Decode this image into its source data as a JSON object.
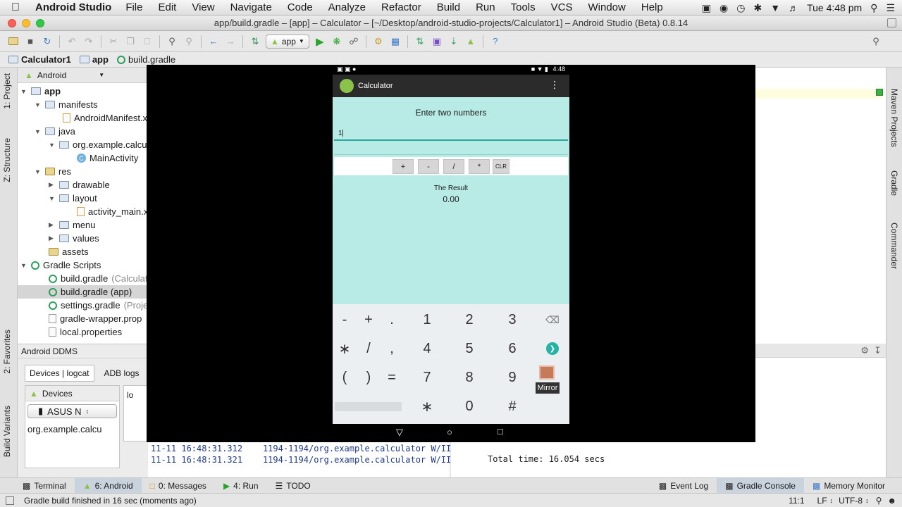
{
  "menubar": {
    "app_name": "Android Studio",
    "items": [
      "File",
      "Edit",
      "View",
      "Navigate",
      "Code",
      "Analyze",
      "Refactor",
      "Build",
      "Run",
      "Tools",
      "VCS",
      "Window",
      "Help"
    ],
    "clock": "Tue 4:48 pm"
  },
  "window": {
    "title": "app/build.gradle – [app] – Calculator – [~/Desktop/android-studio-projects/Calculator1] – Android Studio (Beta) 0.8.14"
  },
  "toolbar": {
    "run_config": "app"
  },
  "breadcrumb": [
    "Calculator1",
    "app",
    "build.gradle"
  ],
  "left_strip": {
    "project": "1: Project",
    "structure": "Z: Structure",
    "favorites": "2: Favorites",
    "build_variants": "Build Variants"
  },
  "right_strip": {
    "maven": "Maven Projects",
    "gradle": "Gradle",
    "commander": "Commander"
  },
  "project_panel": {
    "view_mode": "Android",
    "tree": [
      {
        "label": "app",
        "bold": true
      },
      {
        "label": "manifests"
      },
      {
        "label": "AndroidManifest.x"
      },
      {
        "label": "java"
      },
      {
        "label": "org.example.calcu"
      },
      {
        "label": "MainActivity"
      },
      {
        "label": "res"
      },
      {
        "label": "drawable"
      },
      {
        "label": "layout"
      },
      {
        "label": "activity_main.x"
      },
      {
        "label": "menu"
      },
      {
        "label": "values"
      },
      {
        "label": "assets"
      },
      {
        "label": "Gradle Scripts"
      },
      {
        "label": "build.gradle",
        "hint": "(Calculat"
      },
      {
        "label": "build.gradle (app)"
      },
      {
        "label": "settings.gradle",
        "hint": "(Proje"
      },
      {
        "label": "gradle-wrapper.prop"
      },
      {
        "label": "local.properties"
      }
    ]
  },
  "ddms": {
    "title": "Android DDMS",
    "tabs": [
      "Devices | logcat",
      "ADB logs"
    ],
    "devices_label": "Devices",
    "device_select": "ASUS N",
    "process": "org.example.calcu",
    "log_tab": "lo"
  },
  "logcat": [
    {
      "time": "11-11 16:48:31.312",
      "msg": "1194-1194/org.example.calculator W/II"
    },
    {
      "time": "11-11 16:48:31.321",
      "msg": "1194-1194/org.example.calculator W/II"
    }
  ],
  "gradle_console": {
    "total_time": "Total time: 16.054 secs"
  },
  "phone": {
    "status_time": "4:48",
    "app_title": "Calculator",
    "prompt": "Enter two numbers",
    "input1_value": "1",
    "ops": [
      "+",
      "-",
      "/",
      "*",
      "CLR"
    ],
    "result_label": "The Result",
    "result_value": "0.00",
    "keyboard": {
      "row1": [
        "-",
        "+",
        ".",
        "1",
        "2",
        "3"
      ],
      "row2": [
        "∗",
        "/",
        ",",
        "4",
        "5",
        "6"
      ],
      "row3": [
        "(",
        ")",
        "=",
        "7",
        "8",
        "9"
      ],
      "row4": [
        "∗",
        "0",
        "#"
      ],
      "mirror_label": "Mirror"
    }
  },
  "bottom_tabs": [
    {
      "label": "Terminal"
    },
    {
      "label": "6: Android"
    },
    {
      "label": "0: Messages"
    },
    {
      "label": "4: Run"
    },
    {
      "label": "TODO"
    }
  ],
  "bottom_tabs_right": [
    "Event Log",
    "Gradle Console",
    "Memory Monitor"
  ],
  "status": {
    "message": "Gradle build finished in 16 sec (moments ago)",
    "position": "11:1",
    "line_sep": "LF",
    "encoding": "UTF-8"
  }
}
